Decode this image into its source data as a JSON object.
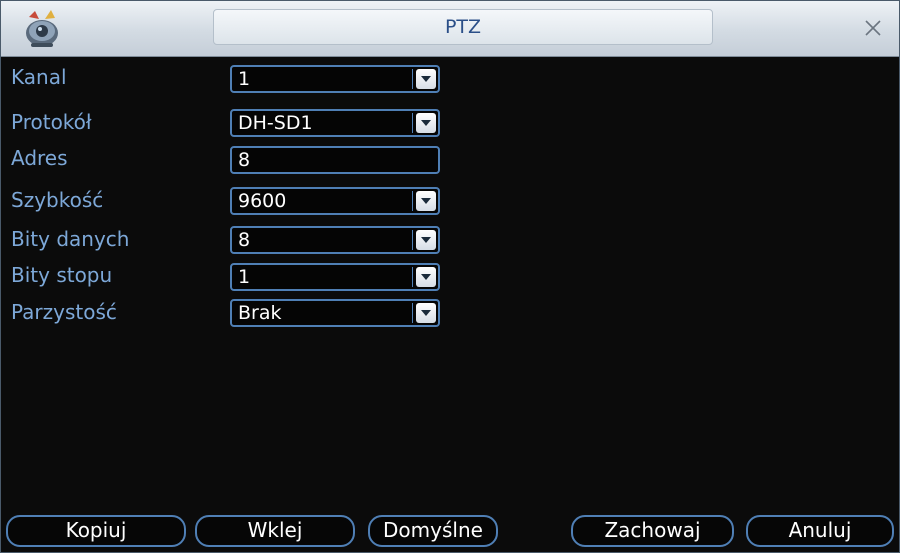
{
  "window": {
    "title": "PTZ",
    "app_icon": "dvr-camera-icon",
    "close_icon": "close-icon"
  },
  "form": {
    "kanal": {
      "label": "Kanal",
      "value": "1",
      "type": "select"
    },
    "protokol": {
      "label": "Protokół",
      "value": "DH-SD1",
      "type": "select"
    },
    "adres": {
      "label": "Adres",
      "value": "8",
      "type": "text"
    },
    "szybkosc": {
      "label": "Szybkość",
      "value": "9600",
      "type": "select"
    },
    "bity_danych": {
      "label": "Bity danych",
      "value": "8",
      "type": "select"
    },
    "bity_stopu": {
      "label": "Bity stopu",
      "value": "1",
      "type": "select"
    },
    "parzystosc": {
      "label": "Parzystość",
      "value": "Brak",
      "type": "select"
    }
  },
  "buttons": {
    "kopiuj": "Kopiuj",
    "wklej": "Wklej",
    "domyslne": "Domyślne",
    "zachowaj": "Zachowaj",
    "anuluj": "Anuluj"
  },
  "colors": {
    "label_text": "#7da8d8",
    "field_border": "#4f7fb5",
    "title_text": "#2b4f88",
    "background": "#0b0b0b"
  }
}
